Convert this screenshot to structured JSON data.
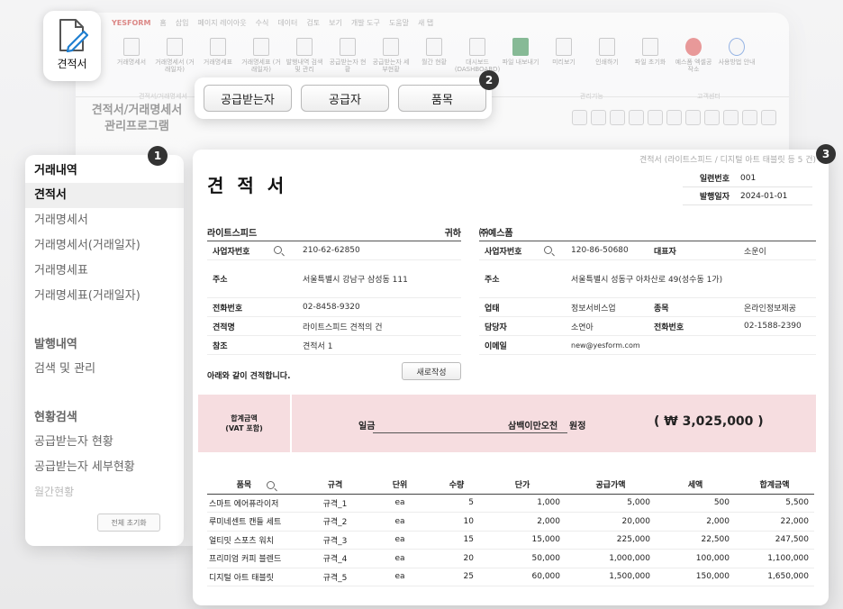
{
  "bg": {
    "tabs": [
      "YESFORM",
      "홈",
      "삽입",
      "페이지 레이아웃",
      "수식",
      "데이터",
      "검토",
      "보기",
      "개발 도구",
      "도움말",
      "새 탭"
    ],
    "ribbon": [
      {
        "label": "거래명세서",
        "style": "doc"
      },
      {
        "label": "거래명세서 (거래일자)",
        "style": "doc"
      },
      {
        "label": "거래명세표",
        "style": "doc"
      },
      {
        "label": "거래명세표 (거래일자)",
        "style": "doc"
      },
      {
        "label": "발행내역 검색 및 관리",
        "style": "doc"
      },
      {
        "label": "공급받는자 현황",
        "style": "doc"
      },
      {
        "label": "공급받는자 세부현황",
        "style": "doc"
      },
      {
        "label": "월간 현황",
        "style": "doc"
      },
      {
        "label": "대시보드 (DASHBOARD)",
        "style": "doc"
      },
      {
        "label": "파일 내보내기",
        "style": "excel"
      },
      {
        "label": "미리보기",
        "style": "doc"
      },
      {
        "label": "인쇄하기",
        "style": "doc"
      },
      {
        "label": "파일 초기화",
        "style": "doc"
      },
      {
        "label": "예스폼 엑셀공작소",
        "style": "red"
      },
      {
        "label": "사용방법 안내",
        "style": "blue"
      }
    ],
    "group1": "견적서/거래명세서",
    "group2": "관리기능",
    "group3": "고객센터",
    "app_title_line1": "견적서/거래명세서",
    "app_title_line2": "관리프로그램"
  },
  "app_icon": {
    "label": "견적서",
    "icon": "document-pen-icon"
  },
  "badges": {
    "one": "1",
    "two": "2",
    "three": "3"
  },
  "callout": {
    "buttons": [
      "공급받는자",
      "공급자",
      "품목"
    ]
  },
  "menu": {
    "section1": "거래내역",
    "items1": [
      "견적서",
      "거래명세서",
      "거래명세서(거래일자)",
      "거래명세표",
      "거래명세표(거래일자)"
    ],
    "active": "견적서",
    "section2": "발행내역",
    "items2": [
      "검색 및 관리"
    ],
    "section3": "현황검색",
    "items3": [
      "공급받는자 현황",
      "공급받는자 세부현황"
    ],
    "faded": "월간현황",
    "reset": "전체 초기화"
  },
  "doc": {
    "crumb": "견적서 (라이트스피드 / 디지털 아트 태블릿 등 5 건)",
    "title": "견 적 서",
    "meta": [
      {
        "k": "일련번호",
        "v": "001"
      },
      {
        "k": "발행일자",
        "v": "2024-01-01"
      }
    ],
    "buyer": {
      "name": "라이트스피드",
      "honorific": "귀하",
      "rows": [
        {
          "k": "사업자번호",
          "v": "210-62-62850",
          "search": true
        },
        {
          "k": "주소",
          "v": "서울특별시 강남구 삼성동 111"
        },
        {
          "k": "전화번호",
          "v": "02-8458-9320"
        },
        {
          "k": "견적명",
          "v": "라이트스피드 견적의 건"
        },
        {
          "k": "참조",
          "v": "견적서 1"
        }
      ]
    },
    "supplier": {
      "name": "㈜예스폼",
      "biz_no_label": "사업자번호",
      "biz_no": "120-86-50680",
      "ceo_label": "대표자",
      "ceo": "소운이",
      "addr_label": "주소",
      "addr": "서울특별시 성동구 아차산로 49(성수동 1가)",
      "type_label": "업태",
      "type": "정보서비스업",
      "item_label": "종목",
      "item": "온라인정보제공",
      "manager_label": "담당자",
      "manager": "소연아",
      "tel_label": "전화번호",
      "tel": "02-1588-2390",
      "email_label": "이메일",
      "email": "new@yesform.com"
    },
    "intro": "아래와 같이 견적합니다.",
    "new_button": "새로작성",
    "total": {
      "label_line1": "합계금액",
      "label_line2": "(VAT 포함)",
      "prefix": "일금",
      "korean": "삼백이만오천",
      "suffix": "원정",
      "amount": "( ₩ 3,025,000 )"
    },
    "table": {
      "headers": [
        "품목",
        "규격",
        "단위",
        "수량",
        "단가",
        "공급가액",
        "세액",
        "합계금액"
      ],
      "rows": [
        [
          "스마트 에어퓨라이저",
          "규격_1",
          "ea",
          "5",
          "1,000",
          "5,000",
          "500",
          "5,500"
        ],
        [
          "루미네센트 캔들 세트",
          "규격_2",
          "ea",
          "10",
          "2,000",
          "20,000",
          "2,000",
          "22,000"
        ],
        [
          "얼티밋 스포츠 워치",
          "규격_3",
          "ea",
          "15",
          "15,000",
          "225,000",
          "22,500",
          "247,500"
        ],
        [
          "프리미엄 커피 블렌드",
          "규격_4",
          "ea",
          "20",
          "50,000",
          "1,000,000",
          "100,000",
          "1,100,000"
        ],
        [
          "디지털 아트 태블릿",
          "규격_5",
          "ea",
          "25",
          "60,000",
          "1,500,000",
          "150,000",
          "1,650,000"
        ]
      ]
    }
  }
}
